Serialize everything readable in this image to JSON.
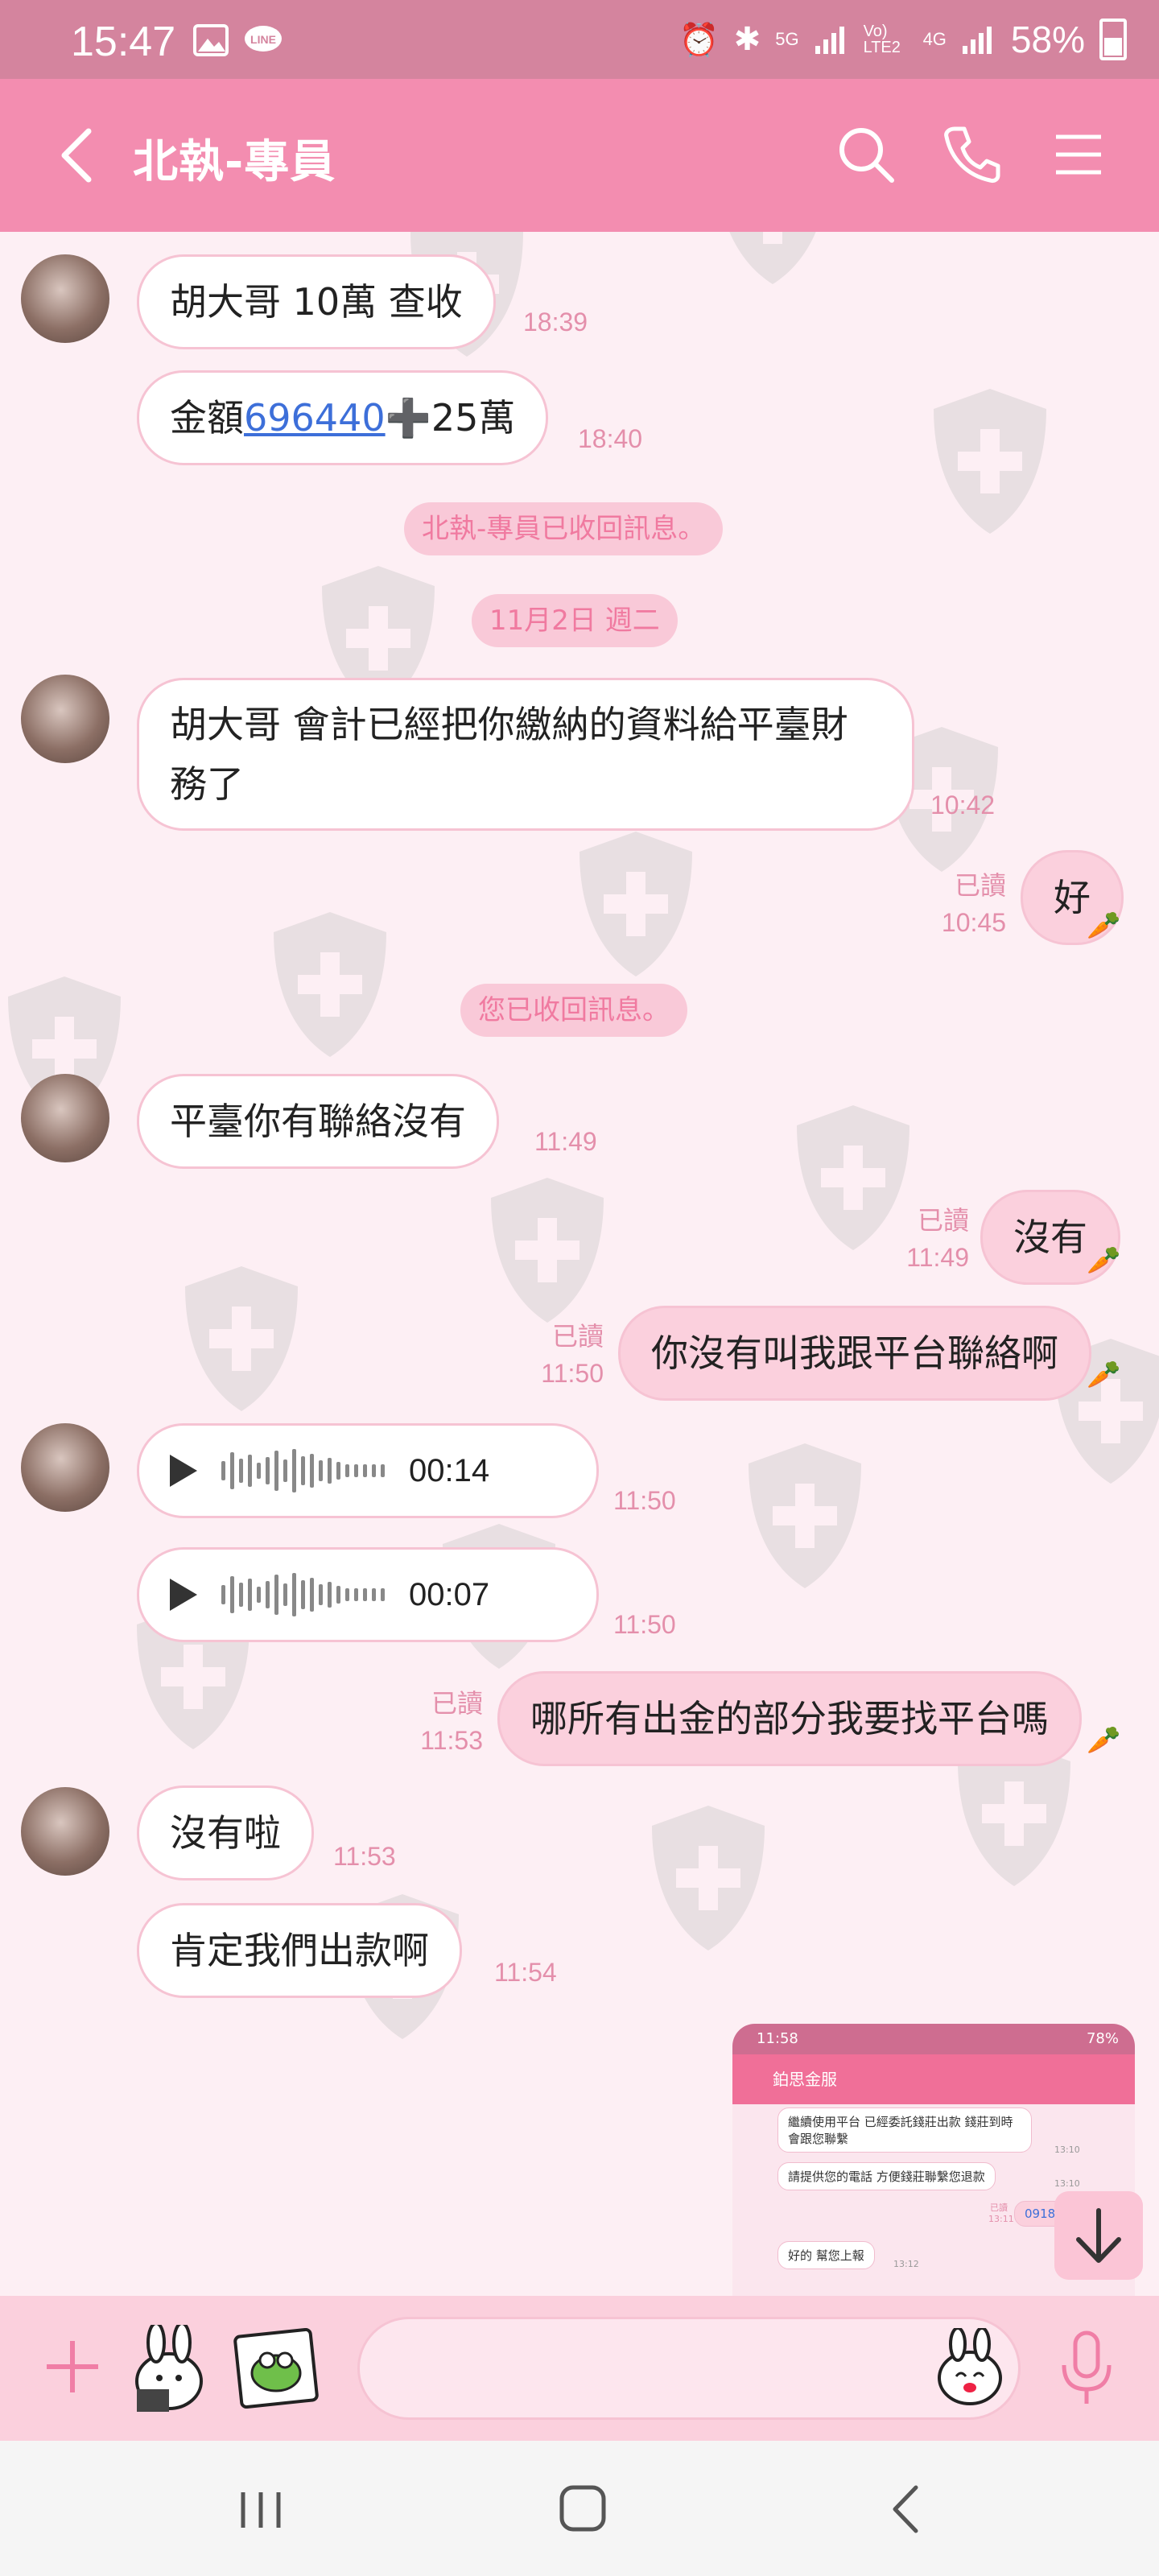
{
  "status_bar": {
    "time": "15:47",
    "network_5g": "5G",
    "volte": "Vo) LTE2",
    "network_4g": "4G",
    "battery": "58%"
  },
  "header": {
    "title": "北執-專員"
  },
  "messages": [
    {
      "text": "胡大哥 10萬 查收",
      "time": "18:39"
    },
    {
      "prefix": "金額",
      "link": "696440",
      "suffix": "➕25萬",
      "time": "18:40"
    },
    {
      "system": "北執-專員已收回訊息。"
    },
    {
      "system": "11月2日 週二"
    },
    {
      "text": "胡大哥 會計已經把你繳納的資料給平臺財務了",
      "time": "10:42"
    },
    {
      "text": "好",
      "read": "已讀",
      "time": "10:45"
    },
    {
      "system": "您已收回訊息。"
    },
    {
      "text": "平臺你有聯絡沒有",
      "time": "11:49"
    },
    {
      "text": "沒有",
      "read": "已讀",
      "time": "11:49"
    },
    {
      "text": "你沒有叫我跟平台聯絡啊",
      "read": "已讀",
      "time": "11:50"
    },
    {
      "voice_duration": "00:14",
      "time": "11:50"
    },
    {
      "voice_duration": "00:07",
      "time": "11:50"
    },
    {
      "text": "哪所有出金的部分我要找平台嗎",
      "read": "已讀",
      "time": "11:53"
    },
    {
      "text": "沒有啦",
      "time": "11:53"
    },
    {
      "text": "肯定我們出款啊",
      "time": "11:54"
    }
  ],
  "shared_screenshot": {
    "time": "11:58",
    "battery": "78%",
    "title": "鉑思金服",
    "msg1": "繼續使用平台 已經委託錢莊出款 錢莊到時會跟您聯繫",
    "msg1_time": "13:10",
    "msg2": "請提供您的電話 方便錢莊聯繫您退款",
    "msg2_time": "13:10",
    "read": "已讀",
    "read_time": "13:11",
    "msg3": "0918",
    "msg4": "好的 幫您上報",
    "msg4_time": "13:12"
  },
  "colors": {
    "header": "#f38db0",
    "status_bar": "#d4849e",
    "chat_bg": "#fdeff4",
    "my_bubble": "#fbd0dd",
    "accent": "#f07ea6"
  }
}
